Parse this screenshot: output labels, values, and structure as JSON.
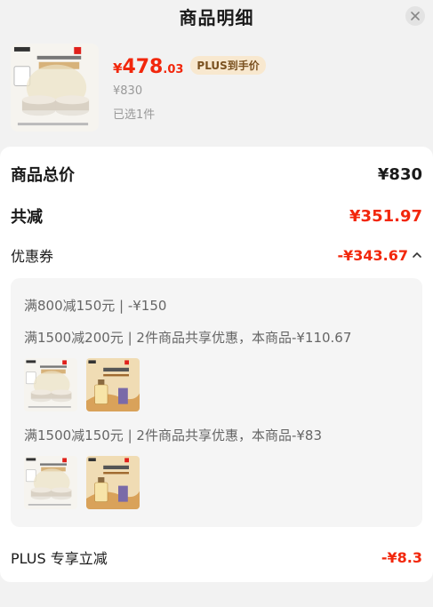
{
  "header": {
    "title": "商品明细",
    "close_icon": "close-icon"
  },
  "product": {
    "image_icon": "cream-jar-product-image",
    "price_symbol": "¥",
    "price_int": "478",
    "price_dec": ".03",
    "plus_badge": "PLUS到手价",
    "original_price": "¥830",
    "selected": "已选1件"
  },
  "summary": {
    "total_label": "商品总价",
    "total_value": "¥830",
    "discount_label": "共减",
    "discount_value": "¥351.97",
    "coupon_label": "优惠券",
    "coupon_value": "-¥343.67",
    "coupon_toggle_icon": "chevron-up-icon"
  },
  "coupons": [
    {
      "text": "满800减150元 | -¥150"
    },
    {
      "text": "满1500减200元 | 2件商品共享优惠，本商品-¥110.67",
      "images": [
        "cream-jar-product-image",
        "perfume-bottle-product-image"
      ]
    },
    {
      "text": "满1500减150元 | 2件商品共享优惠，本商品-¥83",
      "images": [
        "cream-jar-product-image",
        "perfume-bottle-product-image"
      ]
    }
  ],
  "plus": {
    "label": "PLUS 专享立减",
    "value": "-¥8.3"
  },
  "colors": {
    "accent_red": "#f2270c",
    "plus_gold_bg": "#f8e8cf",
    "plus_gold_text": "#7a5120"
  }
}
